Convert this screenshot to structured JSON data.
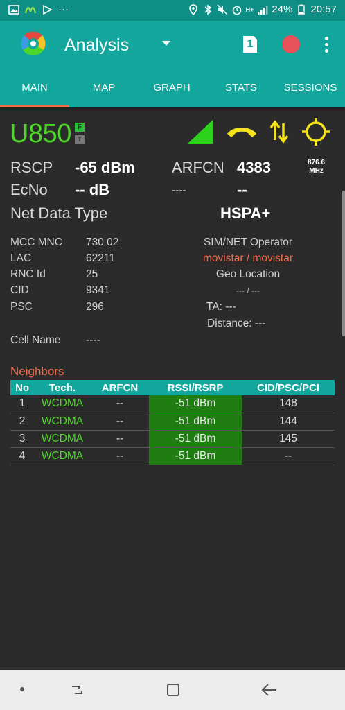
{
  "status_bar": {
    "signal_tag": "H+",
    "battery": "24%",
    "time": "20:57",
    "dots": "···"
  },
  "app_bar": {
    "title": "Analysis",
    "sim_number": "1",
    "record_color": "#e8525a",
    "accent": "#13a69c"
  },
  "tabs": [
    "MAIN",
    "MAP",
    "GRAPH",
    "STATS",
    "SESSIONS"
  ],
  "main": {
    "tech": "U850",
    "badge_f": "F",
    "badge_t": "T",
    "rscp_label": "RSCP",
    "rscp_value": "-65 dBm",
    "arfcn_label": "ARFCN",
    "arfcn_value": "4383",
    "freq_value": "876.6",
    "freq_unit": "MHz",
    "ecno_label": "EcNo",
    "ecno_value": "-- dB",
    "extra_label": "----",
    "extra_value": "--",
    "net_data_label": "Net Data Type",
    "net_data_value": "HSPA+"
  },
  "cell_info": {
    "mcc_mnc_label": "MCC MNC",
    "mcc_mnc_value": "730 02",
    "lac_label": "LAC",
    "lac_value": "62211",
    "rnc_label": "RNC Id",
    "rnc_value": "25",
    "cid_label": "CID",
    "cid_value": "9341",
    "psc_label": "PSC",
    "psc_value": "296",
    "cell_name_label": "Cell Name",
    "cell_name_value": "----",
    "operator_label": "SIM/NET Operator",
    "operator_value": "movistar / movistar",
    "geo_label": "Geo Location",
    "geo_value": "--- / ---",
    "ta_label": "TA: ---",
    "distance_label": "Distance: ---"
  },
  "neighbors": {
    "title": "Neighbors",
    "columns": [
      "No",
      "Tech.",
      "ARFCN",
      "RSSI/RSRP",
      "CID/PSC/PCI"
    ],
    "rows": [
      {
        "no": "1",
        "tech": "WCDMA",
        "arfcn": "--",
        "rssi": "-51 dBm",
        "cid": "148"
      },
      {
        "no": "2",
        "tech": "WCDMA",
        "arfcn": "--",
        "rssi": "-51 dBm",
        "cid": "144"
      },
      {
        "no": "3",
        "tech": "WCDMA",
        "arfcn": "--",
        "rssi": "-51 dBm",
        "cid": "145"
      },
      {
        "no": "4",
        "tech": "WCDMA",
        "arfcn": "--",
        "rssi": "-51 dBm",
        "cid": "--"
      }
    ]
  },
  "icons": {
    "signal": "signal-strength-icon",
    "call": "phone-call-icon",
    "data": "data-transfer-icon",
    "locate": "crosshair-locate-icon"
  }
}
